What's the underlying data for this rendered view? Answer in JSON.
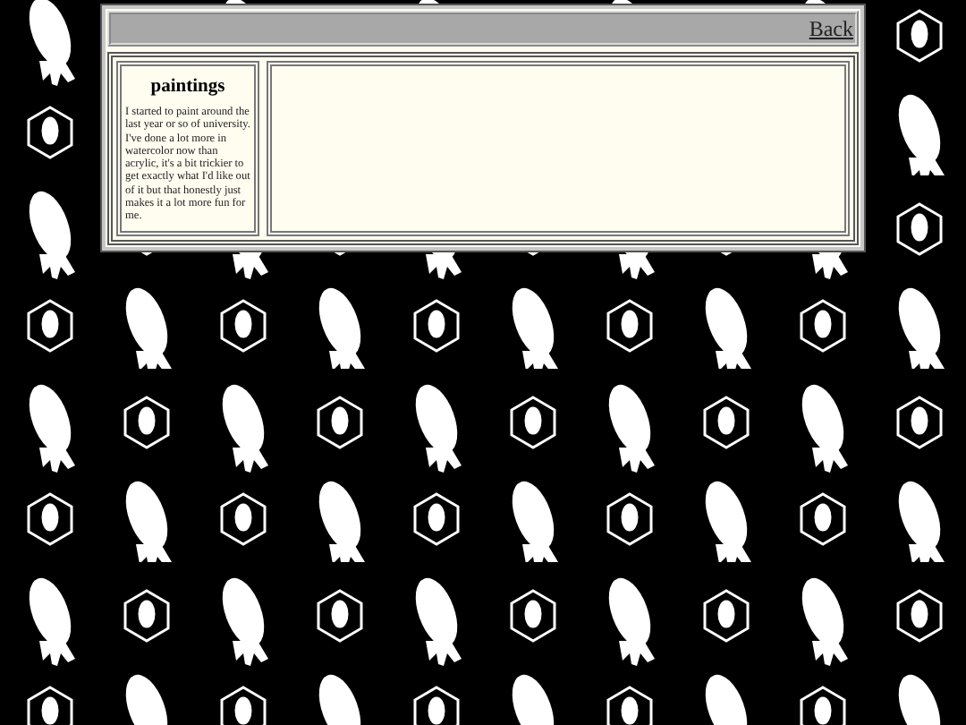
{
  "header": {
    "back_link": "Back"
  },
  "sidebar": {
    "title": "paintings",
    "text": "I started to paint around the last year or so of university. I've done a lot more in watercolor now than acrylic, it's a bit trickier to get exactly what I'd like out of it but that honestly just makes it a lot more fun for me."
  }
}
